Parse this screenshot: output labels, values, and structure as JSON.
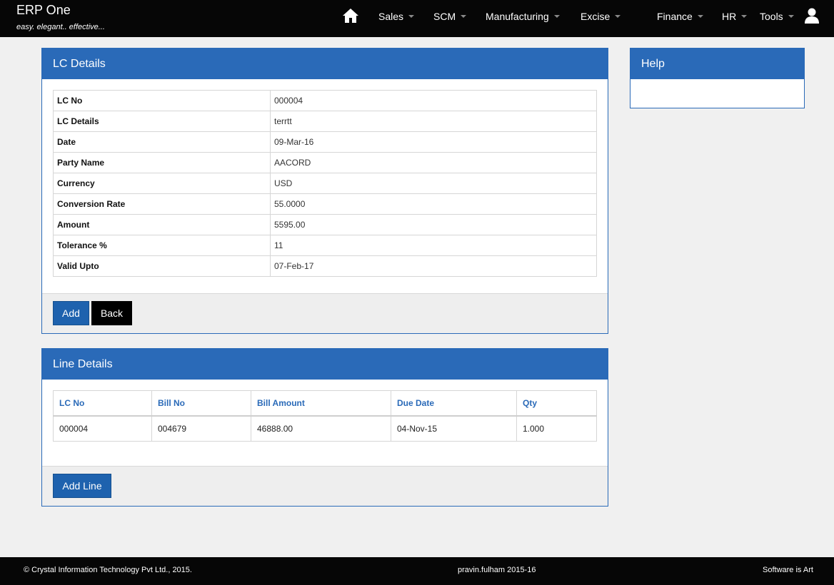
{
  "app": {
    "title": "ERP One",
    "tagline": "easy. elegant.. effective..."
  },
  "nav": {
    "items": [
      {
        "label": "Sales"
      },
      {
        "label": "SCM"
      },
      {
        "label": "Manufacturing"
      },
      {
        "label": "Excise"
      },
      {
        "label": "Finance"
      },
      {
        "label": "HR"
      },
      {
        "label": "Tools"
      }
    ]
  },
  "lc_panel": {
    "title": "LC Details",
    "rows": [
      {
        "label": "LC No",
        "value": "000004"
      },
      {
        "label": "LC Details",
        "value": "terrtt"
      },
      {
        "label": "Date",
        "value": "09-Mar-16"
      },
      {
        "label": "Party Name",
        "value": "AACORD"
      },
      {
        "label": "Currency",
        "value": "USD"
      },
      {
        "label": "Conversion Rate",
        "value": "55.0000"
      },
      {
        "label": "Amount",
        "value": "5595.00"
      },
      {
        "label": "Tolerance %",
        "value": "11"
      },
      {
        "label": "Valid Upto",
        "value": "07-Feb-17"
      }
    ],
    "add_label": "Add",
    "back_label": "Back"
  },
  "line_panel": {
    "title": "Line Details",
    "columns": [
      "LC No",
      "Bill No",
      "Bill Amount",
      "Due Date",
      "Qty"
    ],
    "rows": [
      [
        "000004",
        "004679",
        "46888.00",
        "04-Nov-15",
        "1.000"
      ]
    ],
    "add_line_label": "Add Line"
  },
  "help_panel": {
    "title": "Help"
  },
  "footer": {
    "copyright": "© Crystal Information Technology Pvt Ltd., 2015.",
    "user": "pravin.fulham 2015-16",
    "slogan": "Software is Art"
  },
  "colors": {
    "accent": "#2a6ab8",
    "navbar": "#060606",
    "button_primary": "#1e62ae"
  }
}
